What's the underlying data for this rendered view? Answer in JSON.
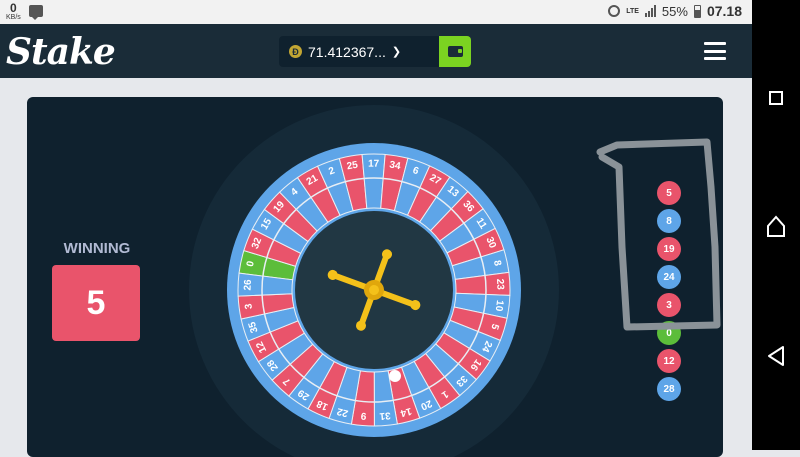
{
  "status_bar": {
    "net_speed_value": "0",
    "net_speed_unit": "KB/s",
    "network_type": "LTE",
    "battery_percent": "55%",
    "time": "07.18"
  },
  "header": {
    "logo_text": "Stake",
    "balance": "71.412367...",
    "coin_symbol": "Ð",
    "menu_icon": "hamburger-icon",
    "wallet_icon": "wallet-icon"
  },
  "game": {
    "winning_label": "WINNING",
    "winning_number": "5",
    "wheel_numbers": [
      "0",
      "32",
      "15",
      "19",
      "4",
      "21",
      "2",
      "25",
      "17",
      "34",
      "6",
      "27",
      "13",
      "36",
      "11",
      "30",
      "8",
      "23",
      "10",
      "5",
      "24",
      "16",
      "33",
      "1",
      "20",
      "14",
      "31",
      "9",
      "22",
      "18",
      "29",
      "7",
      "28",
      "12",
      "35",
      "3",
      "26"
    ],
    "red_numbers": [
      "1",
      "3",
      "5",
      "7",
      "9",
      "12",
      "14",
      "16",
      "18",
      "19",
      "21",
      "23",
      "25",
      "27",
      "30",
      "32",
      "34",
      "36"
    ],
    "history": [
      {
        "value": "5",
        "color": "red"
      },
      {
        "value": "8",
        "color": "blue"
      },
      {
        "value": "19",
        "color": "red"
      },
      {
        "value": "24",
        "color": "blue"
      },
      {
        "value": "3",
        "color": "red"
      },
      {
        "value": "0",
        "color": "green"
      },
      {
        "value": "12",
        "color": "red"
      },
      {
        "value": "28",
        "color": "blue"
      }
    ]
  },
  "colors": {
    "red": "#e9546b",
    "blue": "#5ea5e8",
    "green": "#5cbd3a",
    "accent_green": "#7bd321",
    "gold": "#f4c11a",
    "panel": "#0f212e",
    "header": "#1a2c38"
  },
  "nav_bar": {
    "icons": [
      "recents-icon",
      "home-icon",
      "back-icon"
    ]
  }
}
